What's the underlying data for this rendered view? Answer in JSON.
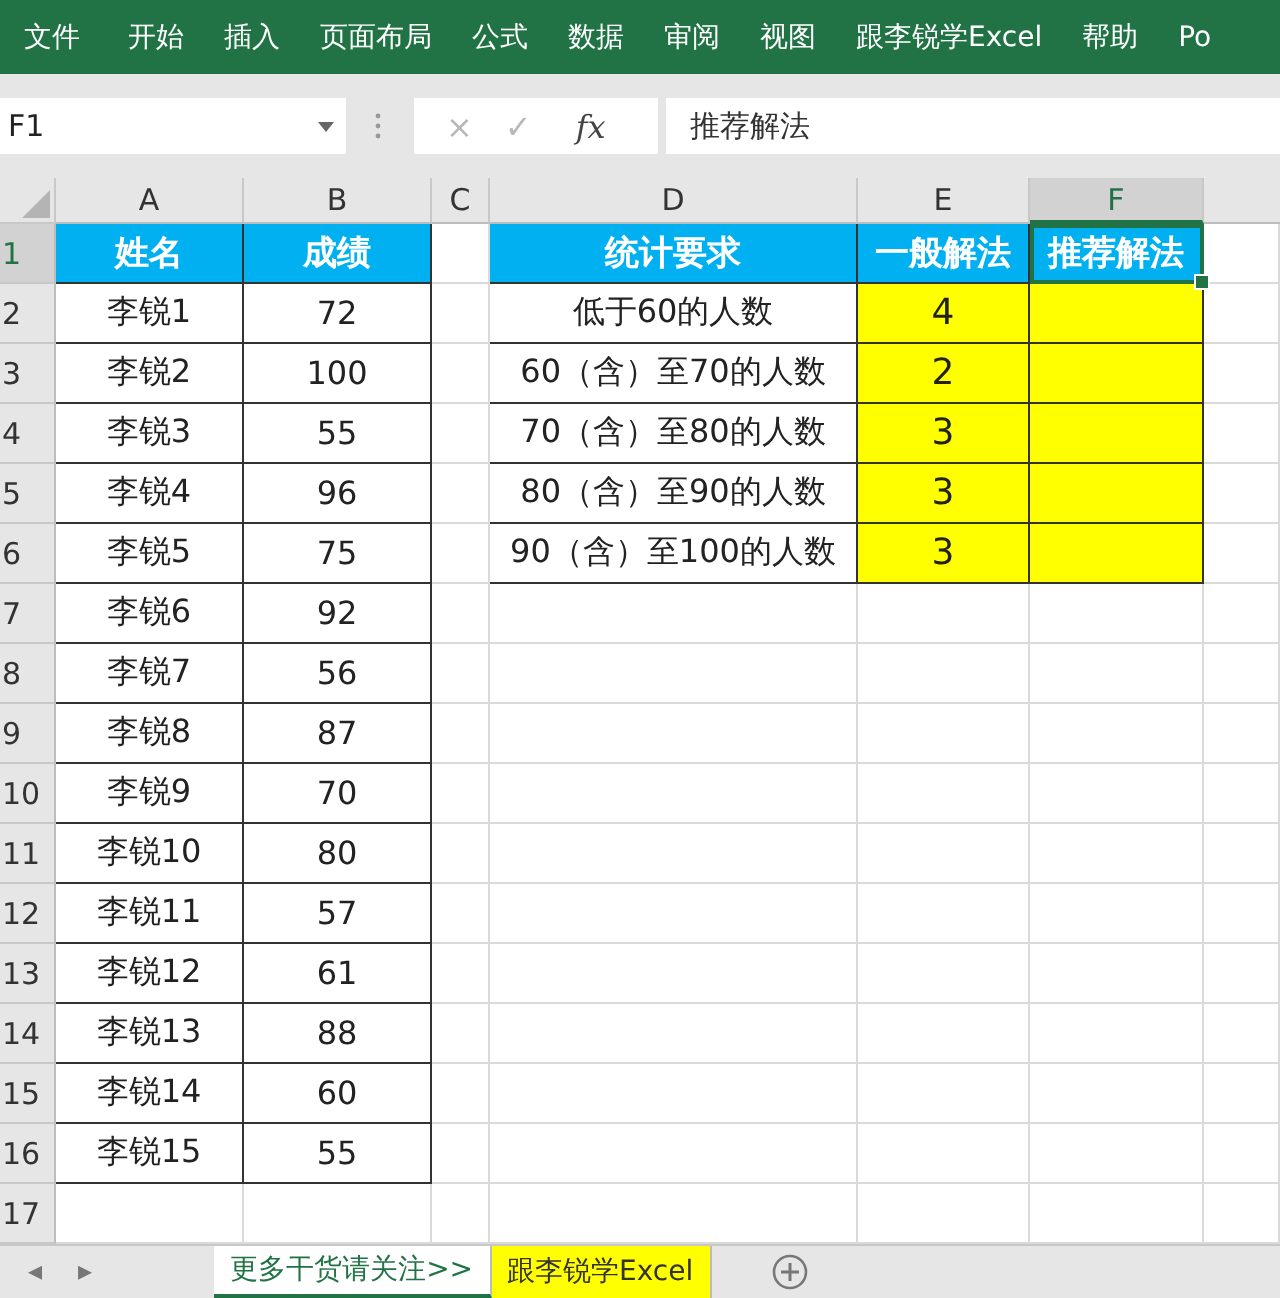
{
  "ribbon_tabs": [
    "文件",
    "开始",
    "插入",
    "页面布局",
    "公式",
    "数据",
    "审阅",
    "视图",
    "跟李锐学Excel",
    "帮助",
    "Po"
  ],
  "name_box": "F1",
  "formula_bar": {
    "cancel": "×",
    "enter": "✓",
    "fx": "fx",
    "value": "推荐解法"
  },
  "sheet_nav": [
    "◂",
    "▸"
  ],
  "columns": [
    {
      "label": "A",
      "selected": false
    },
    {
      "label": "B",
      "selected": false
    },
    {
      "label": "C",
      "selected": false
    },
    {
      "label": "D",
      "selected": false
    },
    {
      "label": "E",
      "selected": false
    },
    {
      "label": "F",
      "selected": true
    }
  ],
  "rows": [
    {
      "number": "1",
      "selected": true,
      "cells": [
        {
          "text": "姓名",
          "kind": "heading"
        },
        {
          "text": "成绩",
          "kind": "heading"
        },
        null,
        {
          "text": "统计要求",
          "kind": "heading"
        },
        {
          "text": "一般解法",
          "kind": "heading"
        },
        {
          "text": "推荐解法",
          "kind": "heading",
          "selected": true
        }
      ]
    },
    {
      "number": "2",
      "selected": false,
      "cells": [
        {
          "text": "李锐1",
          "kind": "bordered"
        },
        {
          "text": "72",
          "kind": "bordered"
        },
        null,
        {
          "text": "低于60的人数",
          "kind": "bordered"
        },
        {
          "text": "4",
          "kind": "highlight"
        },
        {
          "kind": "highlight"
        }
      ]
    },
    {
      "number": "3",
      "selected": false,
      "cells": [
        {
          "text": "李锐2",
          "kind": "bordered"
        },
        {
          "text": "100",
          "kind": "bordered"
        },
        null,
        {
          "text": "60（含）至70的人数",
          "kind": "bordered"
        },
        {
          "text": "2",
          "kind": "highlight"
        },
        {
          "kind": "highlight"
        }
      ]
    },
    {
      "number": "4",
      "selected": false,
      "cells": [
        {
          "text": "李锐3",
          "kind": "bordered"
        },
        {
          "text": "55",
          "kind": "bordered"
        },
        null,
        {
          "text": "70（含）至80的人数",
          "kind": "bordered"
        },
        {
          "text": "3",
          "kind": "highlight"
        },
        {
          "kind": "highlight"
        }
      ]
    },
    {
      "number": "5",
      "selected": false,
      "cells": [
        {
          "text": "李锐4",
          "kind": "bordered"
        },
        {
          "text": "96",
          "kind": "bordered"
        },
        null,
        {
          "text": "80（含）至90的人数",
          "kind": "bordered"
        },
        {
          "text": "3",
          "kind": "highlight"
        },
        {
          "kind": "highlight"
        }
      ]
    },
    {
      "number": "6",
      "selected": false,
      "cells": [
        {
          "text": "李锐5",
          "kind": "bordered"
        },
        {
          "text": "75",
          "kind": "bordered"
        },
        null,
        {
          "text": "90（含）至100的人数",
          "kind": "bordered"
        },
        {
          "text": "3",
          "kind": "highlight"
        },
        {
          "kind": "highlight"
        }
      ]
    },
    {
      "number": "7",
      "selected": false,
      "cells": [
        {
          "text": "李锐6",
          "kind": "bordered"
        },
        {
          "text": "92",
          "kind": "bordered"
        }
      ]
    },
    {
      "number": "8",
      "selected": false,
      "cells": [
        {
          "text": "李锐7",
          "kind": "bordered"
        },
        {
          "text": "56",
          "kind": "bordered"
        }
      ]
    },
    {
      "number": "9",
      "selected": false,
      "cells": [
        {
          "text": "李锐8",
          "kind": "bordered"
        },
        {
          "text": "87",
          "kind": "bordered"
        }
      ]
    },
    {
      "number": "10",
      "selected": false,
      "cells": [
        {
          "text": "李锐9",
          "kind": "bordered"
        },
        {
          "text": "70",
          "kind": "bordered"
        }
      ]
    },
    {
      "number": "11",
      "selected": false,
      "cells": [
        {
          "text": "李锐10",
          "kind": "bordered"
        },
        {
          "text": "80",
          "kind": "bordered"
        }
      ]
    },
    {
      "number": "12",
      "selected": false,
      "cells": [
        {
          "text": "李锐11",
          "kind": "bordered"
        },
        {
          "text": "57",
          "kind": "bordered"
        }
      ]
    },
    {
      "number": "13",
      "selected": false,
      "cells": [
        {
          "text": "李锐12",
          "kind": "bordered"
        },
        {
          "text": "61",
          "kind": "bordered"
        }
      ]
    },
    {
      "number": "14",
      "selected": false,
      "cells": [
        {
          "text": "李锐13",
          "kind": "bordered"
        },
        {
          "text": "88",
          "kind": "bordered"
        }
      ]
    },
    {
      "number": "15",
      "selected": false,
      "cells": [
        {
          "text": "李锐14",
          "kind": "bordered"
        },
        {
          "text": "60",
          "kind": "bordered"
        }
      ]
    },
    {
      "number": "16",
      "selected": false,
      "cells": [
        {
          "text": "李锐15",
          "kind": "bordered"
        },
        {
          "text": "55",
          "kind": "bordered"
        }
      ]
    },
    {
      "number": "17",
      "selected": false,
      "cells": []
    }
  ],
  "sheet_tabs": [
    {
      "label": "更多干货请关注>>",
      "selected": true
    },
    {
      "label": "跟李锐学Excel",
      "selected": false,
      "color": "#ffff00"
    }
  ]
}
